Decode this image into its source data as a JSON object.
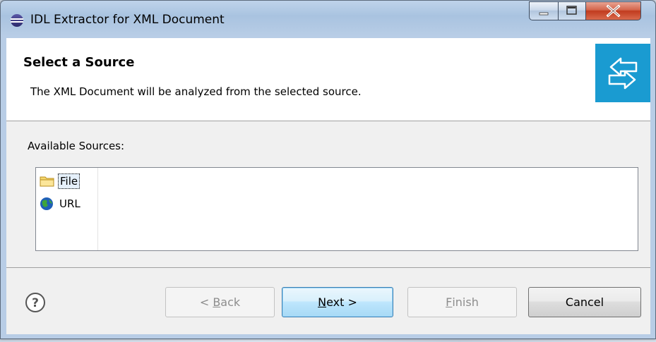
{
  "window": {
    "title": "IDL Extractor for XML Document",
    "controls": {
      "minimize": "minimize",
      "maximize": "maximize",
      "close": "close"
    }
  },
  "header": {
    "title": "Select a Source",
    "description": "The XML Document will be analyzed from the selected source.",
    "icon": "wizard-arrows-icon"
  },
  "sources": {
    "label": "Available Sources:",
    "items": [
      {
        "label": "File",
        "icon": "folder-icon",
        "selected": true
      },
      {
        "label": "URL",
        "icon": "globe-icon",
        "selected": false
      }
    ]
  },
  "buttons": {
    "back": {
      "prefix": "< ",
      "mnemonic": "B",
      "rest": "ack",
      "enabled": false
    },
    "next": {
      "mnemonic": "N",
      "rest": "ext >",
      "enabled": true
    },
    "finish": {
      "mnemonic": "F",
      "rest": "inish",
      "enabled": false
    },
    "cancel": {
      "label": "Cancel",
      "enabled": true
    }
  },
  "colors": {
    "accent": "#1a9bd1",
    "close": "#c13b1e"
  }
}
